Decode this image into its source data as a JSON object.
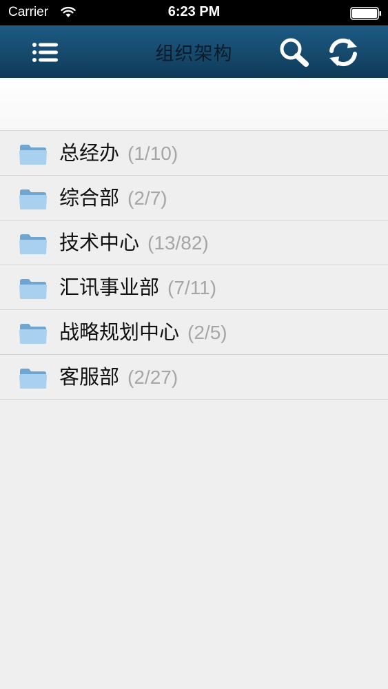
{
  "status_bar": {
    "carrier": "Carrier",
    "time": "6:23 PM"
  },
  "nav_bar": {
    "title": "组织架构",
    "menu_icon": "list-menu-icon",
    "search_icon": "search-icon",
    "refresh_icon": "refresh-icon"
  },
  "departments": [
    {
      "name": "总经办",
      "count": "(1/10)"
    },
    {
      "name": "综合部",
      "count": "(2/7)"
    },
    {
      "name": "技术中心",
      "count": "(13/82)"
    },
    {
      "name": "汇讯事业部",
      "count": "(7/11)"
    },
    {
      "name": "战略规划中心",
      "count": "(2/5)"
    },
    {
      "name": "客服部",
      "count": "(2/27)"
    }
  ],
  "colors": {
    "nav_bar": "#174c70",
    "count_text": "#a6a6a6",
    "folder": "#8fbfe3"
  }
}
